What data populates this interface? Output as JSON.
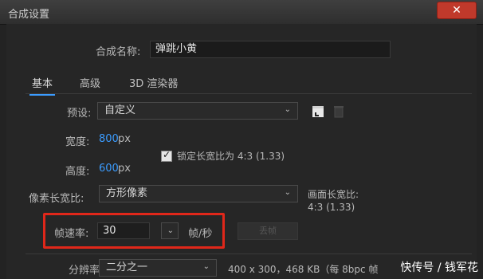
{
  "window": {
    "title": "合成设置",
    "close_glyph": "✕"
  },
  "comp_name": {
    "label": "合成名称:",
    "value": "弹跳小黄"
  },
  "tabs": [
    {
      "label": "基本",
      "active": true
    },
    {
      "label": "高级",
      "active": false
    },
    {
      "label": "3D 渲染器",
      "active": false
    }
  ],
  "preset": {
    "label": "预设:",
    "value": "自定义"
  },
  "width": {
    "label": "宽度:",
    "value": "800",
    "unit": "px"
  },
  "height": {
    "label": "高度:",
    "value": "600",
    "unit": "px"
  },
  "lock_ratio": {
    "label": "锁定长宽比为 4:3 (1.33)",
    "checked": true
  },
  "pixel_aspect": {
    "label": "像素长宽比:",
    "value": "方形像素"
  },
  "frame_aspect": {
    "label": "画面长宽比:",
    "value": "4:3 (1.33)"
  },
  "frame_rate": {
    "label": "帧速率:",
    "value": "30",
    "unit": "帧/秒"
  },
  "drop_frame": {
    "label": "丢帧"
  },
  "resolution": {
    "label": "分辨率:",
    "value": "二分之一",
    "info": "400 x 300，468 KB（每 8bpc 帧"
  },
  "watermark": "快传号 / 钱军花",
  "colors": {
    "accent": "#3b9cff",
    "highlight_box": "#e0271a",
    "background": "#232323"
  }
}
